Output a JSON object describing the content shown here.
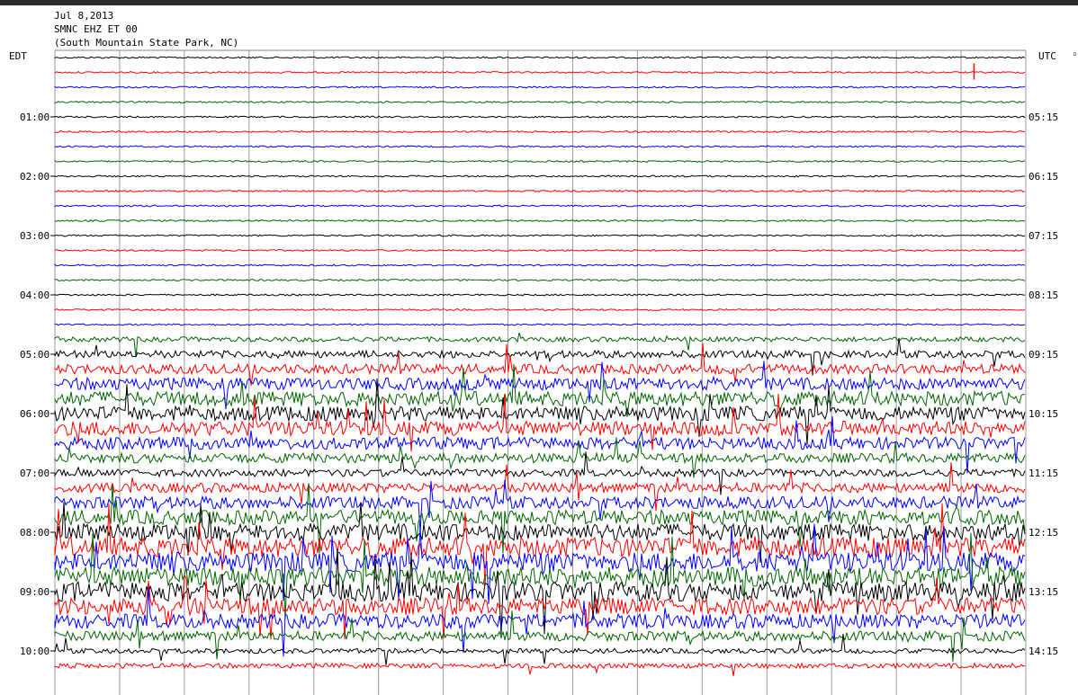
{
  "header": {
    "date": "Jul 8,2013",
    "station": "SMNC EHZ ET 00",
    "location": "(South Mountain State Park, NC)"
  },
  "axis": {
    "left_title": "EDT",
    "right_title": "UTC",
    "right_marker": "▫"
  },
  "chart_data": {
    "type": "line",
    "title": "SMNC EHZ ET 00",
    "trace_colors": [
      "#000000",
      "#ff0000",
      "#0000ff",
      "#006600"
    ],
    "rows_per_hour": 4,
    "minutes_per_row": 15,
    "row_count": 42,
    "left_ticks": [
      "01:00",
      "02:00",
      "03:00",
      "04:00",
      "05:00",
      "06:00",
      "07:00",
      "08:00",
      "09:00",
      "10:00"
    ],
    "right_ticks": [
      "05:15",
      "06:15",
      "07:15",
      "08:15",
      "09:15",
      "10:15",
      "11:15",
      "12:15",
      "13:15",
      "14:15"
    ],
    "activity_level": [
      1,
      1,
      1,
      1,
      1,
      1,
      1,
      1,
      1,
      1,
      1,
      1,
      1,
      1,
      1,
      1,
      1,
      1,
      1,
      2,
      3,
      4,
      5,
      6,
      6,
      6,
      5,
      4,
      3,
      4,
      5,
      6,
      7,
      8,
      8,
      8,
      8,
      7,
      6,
      4,
      2,
      2
    ],
    "event_markers": [
      {
        "row": 1,
        "minute": 14.2
      }
    ]
  }
}
